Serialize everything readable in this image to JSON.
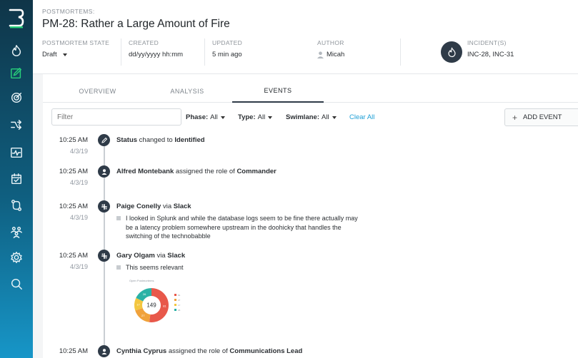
{
  "header": {
    "eyebrow": "POSTMORTEMS:",
    "title": "PM-28: Rather a Large Amount of Fire",
    "state_label": "POSTMORTEM STATE",
    "state_value": "Draft",
    "created_label": "CREATED",
    "created_value": "dd/yy/yyyy hh:mm",
    "updated_label": "UPDATED",
    "updated_value": "5 min ago",
    "author_label": "AUTHOR",
    "author_value": "Micah",
    "incidents_label": "INCIDENT(S)",
    "incidents_value": "INC-28, INC-31"
  },
  "tabs": [
    {
      "label": "OVERVIEW",
      "active": false
    },
    {
      "label": "ANALYSIS",
      "active": false
    },
    {
      "label": "EVENTS",
      "active": true
    }
  ],
  "filters": {
    "placeholder": "Filter",
    "phase_label": "Phase:",
    "phase_value": "All",
    "type_label": "Type:",
    "type_value": "All",
    "swimlane_label": "Swimlane:",
    "swimlane_value": "All",
    "clear_label": "Clear All",
    "add_label": "ADD EVENT"
  },
  "events": [
    {
      "time": "10:25 AM",
      "date": "4/3/19",
      "icon": "pencil-icon",
      "pre": "Status",
      "mid": " changed to ",
      "strong": "Identified",
      "msg": ""
    },
    {
      "time": "10:25 AM",
      "date": "4/3/19",
      "icon": "user-icon",
      "pre": "Alfred Montebank",
      "mid": " assigned the role of ",
      "strong": "Commander",
      "msg": ""
    },
    {
      "time": "10:25 AM",
      "date": "4/3/19",
      "icon": "slack-icon",
      "pre": "Paige Conelly",
      "mid": " via ",
      "strong": "Slack",
      "msg": "I looked in Splunk and while the database logs seem to be fine there actually may be a latency problem somewhere upstream in the doohicky that handles the switching of the technobabble"
    },
    {
      "time": "10:25 AM",
      "date": "4/3/19",
      "icon": "slack-icon",
      "pre": "Gary Olgam",
      "mid": " via ",
      "strong": "Slack",
      "msg": "This seems relevant"
    },
    {
      "time": "10:25 AM",
      "date": "",
      "icon": "user-icon",
      "pre": "Cynthia Cyprus",
      "mid": " assigned the role of ",
      "strong": "Communications Lead",
      "msg": ""
    }
  ],
  "chart_thumbnail": {
    "title": "Open Postmortems",
    "center_value": "149",
    "slice_colors": [
      "#e8584a",
      "#f0a23b",
      "#f3c63f",
      "#2bb2a6"
    ],
    "slice_fractions": [
      0.52,
      0.18,
      0.12,
      0.18
    ],
    "slice_labels": [
      "81",
      "27",
      "17",
      "26"
    ]
  },
  "colors": {
    "accent": "#1e9fd6",
    "sidebar_active": "#28d07a",
    "badge": "#2f3b48"
  }
}
